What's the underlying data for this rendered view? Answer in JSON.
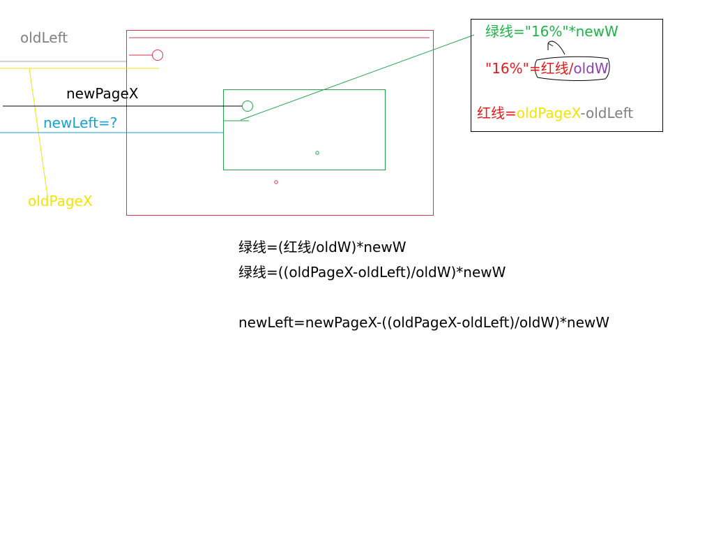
{
  "labels": {
    "old_left": "oldLeft",
    "new_page_x": "newPageX",
    "new_left": "newLeft=?",
    "old_page_x": "oldPageX"
  },
  "note_box": {
    "line1": {
      "part1": "绿线=\"16%\"",
      "part2": "*newW"
    },
    "line2": {
      "part1": "\"16%\"=",
      "part2": "红线/",
      "part3": "oldW"
    },
    "line3": {
      "part1": "红线=",
      "part2": "oldPageX",
      "part3": "-oldLeft"
    }
  },
  "formulas": [
    "绿线=(红线/oldW)*newW",
    "绿线=((oldPageX-oldLeft)/oldW)*newW",
    "newLeft=newPageX-((oldPageX-oldLeft)/oldW)*newW"
  ],
  "colors": {
    "red": "#d9324a",
    "green": "#22a04a",
    "yellow": "#f3e400",
    "cyan": "#15a1d3",
    "gray": "#7f7f7f",
    "black": "#000000",
    "purple": "#8e3fb6"
  }
}
